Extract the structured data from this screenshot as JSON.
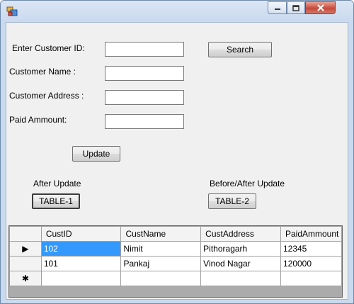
{
  "form": {
    "customer_id_label": "Enter Customer ID:",
    "customer_name_label": "Customer Name :",
    "customer_address_label": "Customer Address :",
    "paid_amount_label": "Paid Ammount:",
    "customer_id_value": "",
    "customer_name_value": "",
    "customer_address_value": "",
    "paid_amount_value": "",
    "search_label": "Search",
    "update_label": "Update"
  },
  "sections": {
    "after_update_label": "After Update",
    "before_after_label": "Before/After Update",
    "table1_label": "TABLE-1",
    "table2_label": "TABLE-2"
  },
  "grid": {
    "columns": [
      "CustID",
      "CustName",
      "CustAddress",
      "PaidAmmount"
    ],
    "rows": [
      [
        "102",
        "Nimit",
        "Pithoragarh",
        "12345"
      ],
      [
        "101",
        "Pankaj",
        "Vinod Nagar",
        "120000"
      ]
    ],
    "current_row_marker": "▶",
    "new_row_marker": "✱"
  },
  "colors": {
    "selection": "#3399ff",
    "close_button": "#c7493a"
  }
}
